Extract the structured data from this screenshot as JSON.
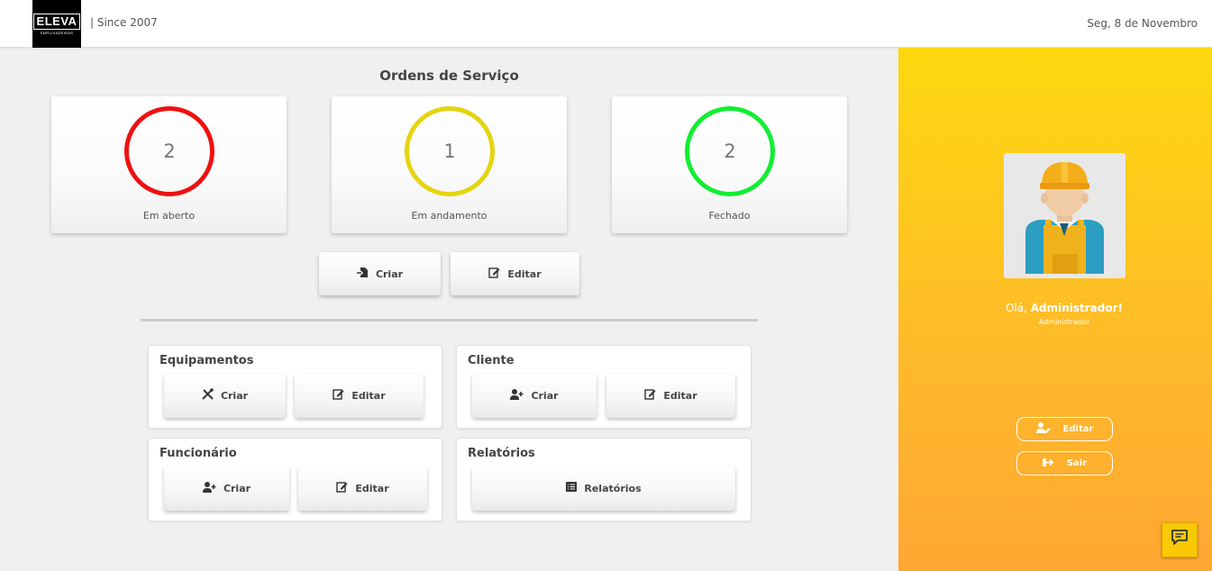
{
  "header": {
    "logo_text": "ELEVA",
    "logo_sub": "EMPILHADEIRAS",
    "since": "| Since 2007",
    "date": "Seg, 8 de Novembro"
  },
  "orders": {
    "title": "Ordens de Serviço",
    "cards": [
      {
        "count": "2",
        "label": "Em aberto",
        "color": "#ee1111"
      },
      {
        "count": "1",
        "label": "Em andamento",
        "color": "#e5d40f"
      },
      {
        "count": "2",
        "label": "Fechado",
        "color": "#11ee33"
      }
    ],
    "create_label": "Criar",
    "edit_label": "Editar"
  },
  "panels": {
    "equipamentos": {
      "title": "Equipamentos",
      "create_label": "Criar",
      "edit_label": "Editar"
    },
    "cliente": {
      "title": "Cliente",
      "create_label": "Criar",
      "edit_label": "Editar"
    },
    "funcionario": {
      "title": "Funcionário",
      "create_label": "Criar",
      "edit_label": "Editar"
    },
    "relatorios": {
      "title": "Relatórios",
      "button_label": "Relatórios"
    }
  },
  "sidebar": {
    "greeting_prefix": "Olá, ",
    "greeting_name": "Administrador!",
    "role": "Administrador",
    "edit_label": "Editar",
    "logout_label": "Sair"
  },
  "icons": {
    "order_create": "file-import-icon",
    "edit": "edit-icon",
    "tools": "tools-icon",
    "user_plus": "user-plus-icon",
    "report": "list-icon",
    "user_edit": "user-edit-icon",
    "logout": "sign-out-icon",
    "chat": "chat-icon"
  }
}
